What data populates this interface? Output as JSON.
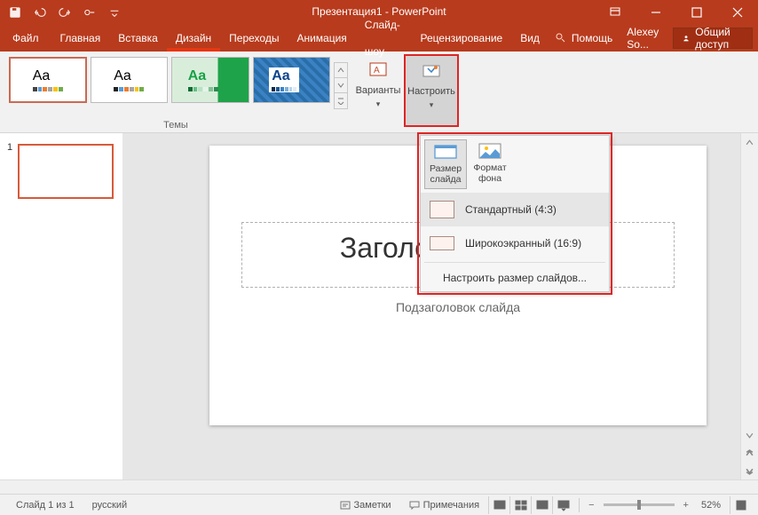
{
  "title": "Презентация1 - PowerPoint",
  "tabs": {
    "file": "Файл",
    "home": "Главная",
    "insert": "Вставка",
    "design": "Дизайн",
    "transitions": "Переходы",
    "animations": "Анимация",
    "slideshow": "Слайд-шоу",
    "review": "Рецензирование",
    "view": "Вид",
    "tell": "Помощь"
  },
  "user": "Alexey So...",
  "share": "Общий доступ",
  "ribbon": {
    "themes_label": "Темы",
    "variants": "Варианты",
    "customize": "Настроить"
  },
  "dropdown": {
    "slide_size": "Размер\nслайда",
    "bg_format": "Формат\nфона",
    "standard": "Стандартный (4:3)",
    "wide": "Широкоэкранный (16:9)",
    "custom": "Настроить размер слайдов..."
  },
  "slide": {
    "number": "1",
    "title_placeholder": "Заголовок слайда",
    "subtitle_placeholder": "Подзаголовок слайда"
  },
  "status": {
    "slide_count": "Слайд 1 из 1",
    "lang": "русский",
    "notes": "Заметки",
    "comments": "Примечания",
    "zoom": "52%"
  }
}
